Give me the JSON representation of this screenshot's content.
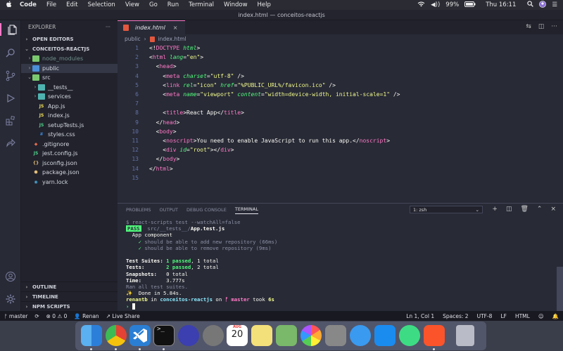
{
  "menubar": {
    "app": "Code",
    "items": [
      "File",
      "Edit",
      "Selection",
      "View",
      "Go",
      "Run",
      "Terminal",
      "Window",
      "Help"
    ],
    "battery": "99%",
    "clock": "Thu 16:11"
  },
  "window_title": "index.html — conceitos-reactjs",
  "sidebar": {
    "title": "EXPLORER",
    "more": "···",
    "open_editors": "OPEN EDITORS",
    "project": "CONCEITOS-REACTJS",
    "items": [
      {
        "label": "node_modules",
        "depth": 1,
        "kind": "folder",
        "expanded": false
      },
      {
        "label": "public",
        "depth": 1,
        "kind": "folder",
        "expanded": false
      },
      {
        "label": "src",
        "depth": 1,
        "kind": "folder",
        "expanded": true
      },
      {
        "label": "__tests__",
        "depth": 2,
        "kind": "folder",
        "expanded": false
      },
      {
        "label": "services",
        "depth": 2,
        "kind": "folder",
        "expanded": false
      },
      {
        "label": "App.js",
        "depth": 2,
        "kind": "js"
      },
      {
        "label": "index.js",
        "depth": 2,
        "kind": "js"
      },
      {
        "label": "setupTests.js",
        "depth": 2,
        "kind": "test"
      },
      {
        "label": "styles.css",
        "depth": 2,
        "kind": "css"
      },
      {
        "label": ".gitignore",
        "depth": 1,
        "kind": "git"
      },
      {
        "label": "jest.config.js",
        "depth": 1,
        "kind": "test"
      },
      {
        "label": "jsconfig.json",
        "depth": 1,
        "kind": "json"
      },
      {
        "label": "package.json",
        "depth": 1,
        "kind": "pkg"
      },
      {
        "label": "yarn.lock",
        "depth": 1,
        "kind": "yarn"
      }
    ],
    "outline": "OUTLINE",
    "timeline": "TIMELINE",
    "npm_scripts": "NPM SCRIPTS"
  },
  "editor": {
    "tab_label": "index.html",
    "tab_close": "×",
    "breadcrumb": [
      "public",
      "index.html"
    ],
    "code_lines": [
      "<!DOCTYPE html>",
      "<html lang=\"en\">",
      "  <head>",
      "    <meta charset=\"utf-8\" />",
      "    <link rel=\"icon\" href=\"%PUBLIC_URL%/favicon.ico\" />",
      "    <meta name=\"viewport\" content=\"width=device-width, initial-scale=1\" />",
      "",
      "    <title>React App</title>",
      "  </head>",
      "  <body>",
      "    <noscript>You need to enable JavaScript to run this app.</noscript>",
      "    <div id=\"root\"></div>",
      "  </body>",
      "</html>",
      ""
    ]
  },
  "panel": {
    "tabs": [
      "PROBLEMS",
      "OUTPUT",
      "DEBUG CONSOLE",
      "TERMINAL"
    ],
    "active_tab": "TERMINAL",
    "terminal_select": "1: zsh",
    "terminal_lines": [
      "$ react-scripts test --watchAll=false",
      "PASS  src/__tests__/App.test.js",
      "  App component",
      "    ✓ should be able to add new repository (66ms)",
      "    ✓ should be able to remove repository (9ms)",
      "",
      "Test Suites: 1 passed, 1 total",
      "Tests:       2 passed, 2 total",
      "Snapshots:   0 total",
      "Time:        3.777s",
      "Ran all test suites.",
      "✨  Done in 5.84s.",
      "renantb in conceitos-reactjs on ᚠ master took 6s",
      "› "
    ]
  },
  "statusbar": {
    "branch": "master",
    "sync": "⟳",
    "errors": "⊗ 0 ⚠ 0",
    "user": "Renan",
    "live_share": "Live Share",
    "position": "Ln 1, Col 1",
    "spaces": "Spaces: 2",
    "encoding": "UTF-8",
    "eol": "LF",
    "language": "HTML"
  },
  "dock": {
    "calendar_month": "AUG",
    "calendar_day": "20"
  },
  "colors": {
    "background": "#282a36",
    "keyword": "#ff79c6",
    "attribute": "#50fa7b",
    "string": "#f1fa8c",
    "pass": "#50fa7b"
  }
}
